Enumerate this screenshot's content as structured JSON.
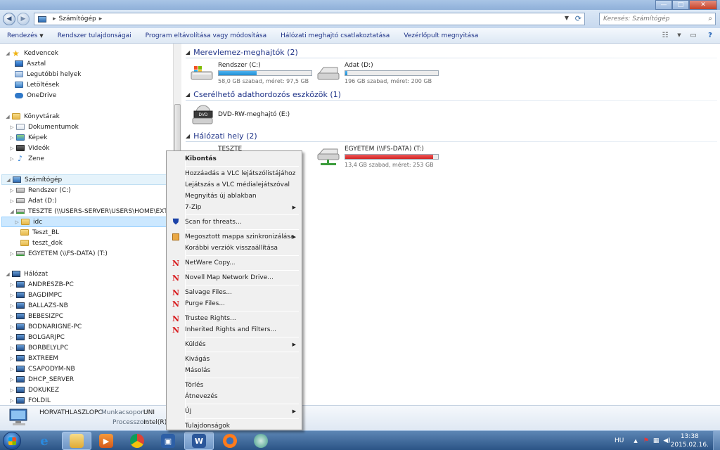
{
  "titlebar": {
    "controls": {
      "minimize": "—",
      "maximize": "□",
      "close": "✕"
    }
  },
  "address": {
    "location": "Számítógép",
    "search_placeholder": "Keresés: Számítógép"
  },
  "toolbar": {
    "organize": "Rendezés",
    "system_properties": "Rendszer tulajdonságai",
    "uninstall": "Program eltávolítása vagy módosítása",
    "map_drive": "Hálózati meghajtó csatlakoztatása",
    "control_panel": "Vezérlőpult megnyitása"
  },
  "nav": {
    "favorites": {
      "label": "Kedvencek",
      "items": [
        "Asztal",
        "Legutóbbi helyek",
        "Letöltések",
        "OneDrive"
      ]
    },
    "libraries": {
      "label": "Könyvtárak",
      "items": [
        "Dokumentumok",
        "Képek",
        "Videók",
        "Zene"
      ]
    },
    "computer": {
      "label": "Számítógép",
      "items": [
        "Rendszer (C:)",
        "Adat (D:)",
        "TESZTE (\\\\USERS-SERVER\\USERS\\HOME\\EXT) (S:)",
        "idc",
        "Teszt_BL",
        "teszt_dok",
        "EGYETEM (\\\\FS-DATA) (T:)"
      ]
    },
    "network": {
      "label": "Hálózat",
      "items": [
        "ANDRESZB-PC",
        "BAGDIMPC",
        "BALLAZS-NB",
        "BEBESIZPC",
        "BODNARIGNE-PC",
        "BOLGARJPC",
        "BORBELYLPC",
        "BXTREEM",
        "CSAPODYM-NB",
        "DHCP_SERVER",
        "DOKUKEZ",
        "FOLDIL"
      ]
    }
  },
  "content": {
    "groups": {
      "hdd": "Merevlemez-meghajtók (2)",
      "removable": "Cserélhető adathordozós eszközök (1)",
      "network": "Hálózati hely (2)"
    },
    "drives": {
      "c": {
        "name": "Rendszer (C:)",
        "info": "58,0 GB szabad, méret: 97,5 GB",
        "used_fraction": 0.41
      },
      "d": {
        "name": "Adat (D:)",
        "info": "196 GB szabad, méret: 200 GB",
        "used_fraction": 0.02
      },
      "dvd": {
        "name": "DVD-RW-meghajtó (E:)",
        "badge": "DVD"
      },
      "s": {
        "name": "TESZTE"
      },
      "t": {
        "name": "EGYETEM (\\\\FS-DATA) (T:)",
        "info": "13,4 GB szabad, méret: 253 GB",
        "used_fraction": 0.95
      }
    }
  },
  "details": {
    "pc_name": "HORVATHLASZLOPC",
    "workgroup_label": "Munkacsoport:",
    "workgroup": "UNI",
    "cpu_label": "Processzor:",
    "cpu": "Intel(R) C"
  },
  "context_menu": {
    "items": [
      {
        "label": "Kibontás",
        "bold": true,
        "icon": ""
      },
      {
        "label": "Hozzáadás a VLC lejátszólistájához",
        "icon": ""
      },
      {
        "label": "Lejátszás a VLC médialejátszóval",
        "icon": ""
      },
      {
        "label": "Megnyitás új ablakban",
        "icon": ""
      },
      {
        "label": "7-Zip",
        "icon": "",
        "submenu": true
      },
      {
        "label": "Scan for threats...",
        "icon": "shield"
      },
      {
        "label": "Megosztott mappa szinkronizálása",
        "icon": "sync",
        "submenu": true
      },
      {
        "label": "Korábbi verziók visszaállítása",
        "icon": ""
      },
      {
        "label": "NetWare Copy...",
        "icon": "novell"
      },
      {
        "label": "Novell Map Network Drive...",
        "icon": "novell"
      },
      {
        "label": "Salvage Files...",
        "icon": "novell"
      },
      {
        "label": "Purge Files...",
        "icon": "novell"
      },
      {
        "label": "Trustee Rights...",
        "icon": "novell"
      },
      {
        "label": "Inherited Rights and Filters...",
        "icon": "novell"
      },
      {
        "label": "Küldés",
        "icon": "",
        "submenu": true
      },
      {
        "label": "Kivágás",
        "icon": ""
      },
      {
        "label": "Másolás",
        "icon": ""
      },
      {
        "label": "Törlés",
        "icon": ""
      },
      {
        "label": "Átnevezés",
        "icon": ""
      },
      {
        "label": "Új",
        "icon": "",
        "submenu": true
      },
      {
        "label": "Tulajdonságok",
        "icon": ""
      }
    ],
    "novell_glyph": "N",
    "shield_glyph": "⛊"
  },
  "taskbar": {
    "language": "HU",
    "time": "13:38",
    "date": "2015.02.16."
  }
}
